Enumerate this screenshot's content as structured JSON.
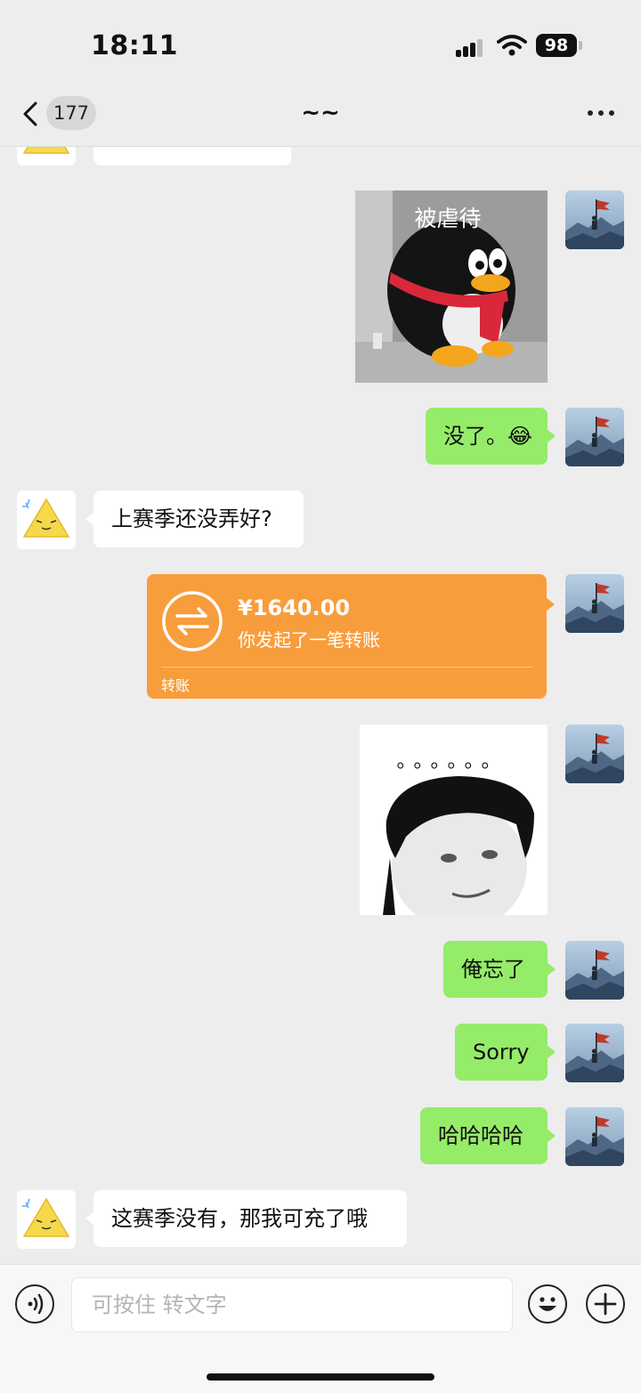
{
  "status": {
    "time": "18:11",
    "battery": "98"
  },
  "nav": {
    "unread_count": "177",
    "title": "~~"
  },
  "messages": {
    "self_img1_caption": "被虐待",
    "self_text1": "没了。😂",
    "other_text1": "上赛季还没弄好?",
    "transfer": {
      "amount": "¥1640.00",
      "description": "你发起了一笔转账",
      "label": "转账"
    },
    "self_img2_caption": "。。。。。。",
    "self_text2": "俺忘了",
    "self_text3": "Sorry",
    "self_text4": "哈哈哈哈",
    "other_text2": "这赛季没有，那我可充了哦"
  },
  "input": {
    "placeholder": "可按住 转文字"
  },
  "colors": {
    "self_bubble": "#95ec69",
    "other_bubble": "#ffffff",
    "transfer_card": "#f89d3c",
    "background": "#ededed"
  }
}
